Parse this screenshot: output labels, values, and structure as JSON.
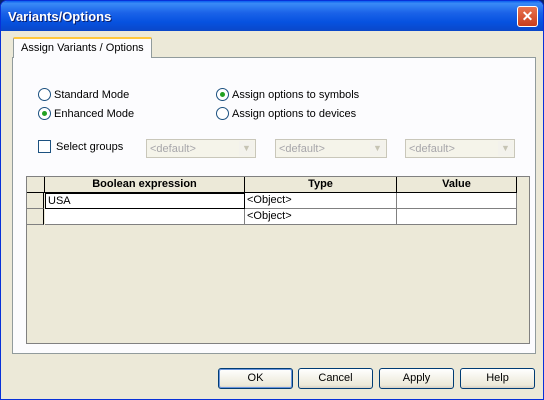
{
  "window": {
    "title": "Variants/Options",
    "close_glyph": "✕"
  },
  "tab": {
    "label": "Assign Variants / Options"
  },
  "mode_options": [
    {
      "label": "Standard Mode",
      "selected": false
    },
    {
      "label": "Enhanced Mode",
      "selected": true
    }
  ],
  "assign_options": [
    {
      "label": "Assign options to symbols",
      "selected": true
    },
    {
      "label": "Assign options to devices",
      "selected": false
    }
  ],
  "select_groups": {
    "label": "Select groups",
    "checked": false
  },
  "combos": [
    "<default>",
    "<default>",
    "<default>"
  ],
  "table": {
    "headers": [
      "Boolean expression",
      "Type",
      "Value"
    ],
    "rows": [
      {
        "expression": "USA",
        "type": "<Object>",
        "value": ""
      },
      {
        "expression": "",
        "type": "<Object>",
        "value": ""
      }
    ]
  },
  "buttons": {
    "ok": "OK",
    "cancel": "Cancel",
    "apply": "Apply",
    "help": "Help"
  }
}
